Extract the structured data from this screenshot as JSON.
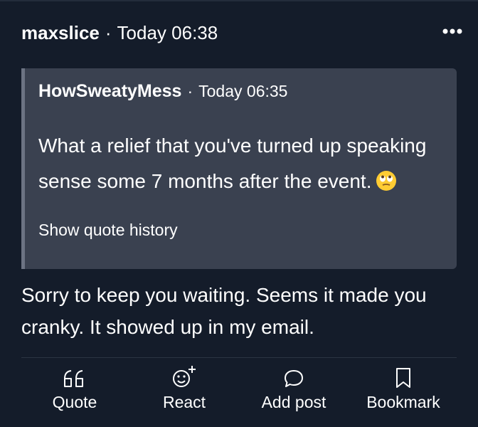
{
  "post": {
    "author": "maxslice",
    "separator": "·",
    "timestamp": "Today 06:38",
    "more_icon": "more-horizontal-icon",
    "body": "Sorry to keep you waiting. Seems it made you cranky. It showed up in my email."
  },
  "quote": {
    "author": "HowSweatyMess",
    "separator": "·",
    "timestamp": "Today 06:35",
    "body": "What a relief that you've turned up speaking sense some 7 months after the event.",
    "emoji": "eye-roll-emoji",
    "show_history_label": "Show quote history"
  },
  "actions": {
    "quote": {
      "label": "Quote",
      "icon": "quote-icon"
    },
    "react": {
      "label": "React",
      "icon": "react-smiley-icon"
    },
    "add_post": {
      "label": "Add post",
      "icon": "speech-bubble-icon"
    },
    "bookmark": {
      "label": "Bookmark",
      "icon": "bookmark-icon"
    }
  },
  "colors": {
    "background": "#141c2a",
    "quote_background": "#3a4150",
    "quote_bar": "#6c7383",
    "text": "#ffffff"
  }
}
